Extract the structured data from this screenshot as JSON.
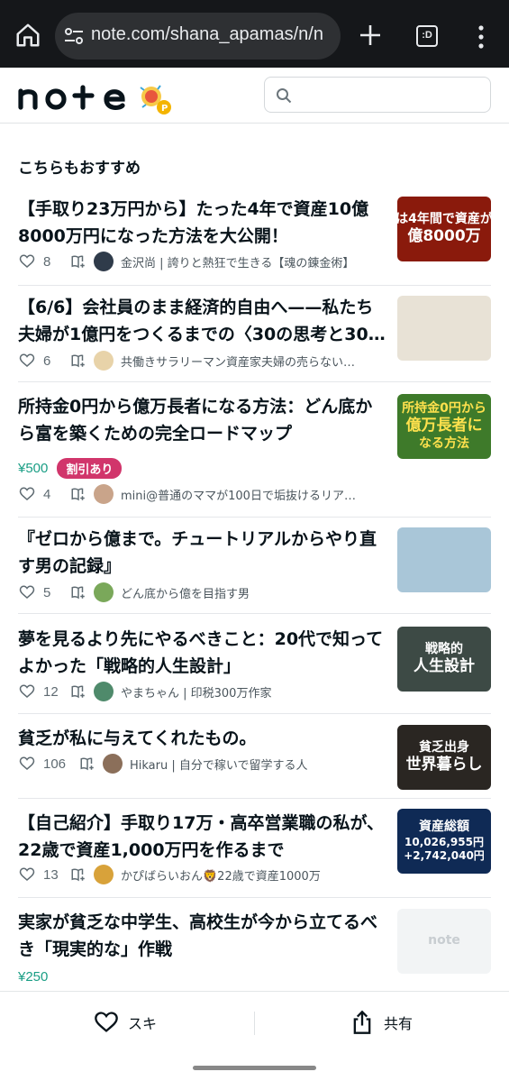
{
  "browser": {
    "url": "note.com/shana_apamas/n/n",
    "tab_icon_label": ":D"
  },
  "header": {
    "logo_text": "note",
    "search_placeholder": ""
  },
  "section": {
    "title": "こちらもおすすめ"
  },
  "articles": [
    {
      "title": "【手取り23万円から】たった4年で資産10億8000万円になった方法を大公開！",
      "likes": "8",
      "author": "金沢尚 | 誇りと熱狂で生きる【魂の錬金術】",
      "price": "",
      "badge": "",
      "thumb_text_1": "は4年間で資産が",
      "thumb_text_2": "億8000万",
      "thumb_bg": "#8a1a0c",
      "avatar_color": "#2f3b4a"
    },
    {
      "title": "【6/6】会社員のまま経済的自由へ——私たち夫婦が1億円をつくるまでの〈30の思考と30…",
      "likes": "6",
      "author": "共働きサラリーマン資産家夫婦の売らない…",
      "price": "",
      "badge": "",
      "thumb_text_1": "",
      "thumb_text_2": "",
      "thumb_bg": "#e8e2d6",
      "avatar_color": "#e8d3a9"
    },
    {
      "title": "所持金0円から億万長者になる方法：どん底から富を築くための完全ロードマップ",
      "likes": "4",
      "author": "mini@普通のママが100日で垢抜けるリア…",
      "price": "¥500",
      "badge": "割引あり",
      "thumb_text_1": "所持金0円から",
      "thumb_text_2": "億万長者に",
      "thumb_text_3": "なる方法",
      "thumb_bg": "#3e7a2a",
      "avatar_color": "#c9a48a"
    },
    {
      "title": "『ゼロから億まで。チュートリアルからやり直す男の記録』",
      "likes": "5",
      "author": "どん底から億を目指す男",
      "price": "",
      "badge": "",
      "thumb_text_1": "",
      "thumb_text_2": "",
      "thumb_bg": "#a9c6d8",
      "avatar_color": "#7aa85a"
    },
    {
      "title": "夢を見るより先にやるべきこと：20代で知ってよかった「戦略的人生設計」",
      "likes": "12",
      "author": "やまちゃん | 印税300万作家",
      "price": "",
      "badge": "",
      "thumb_text_1": "戦略的",
      "thumb_text_2": "人生設計",
      "thumb_bg": "#3d4a45",
      "avatar_color": "#4f8a6b"
    },
    {
      "title": "貧乏が私に与えてくれたもの。",
      "likes": "106",
      "author": "Hikaru | 自分で稼いで留学する人",
      "price": "",
      "badge": "",
      "thumb_text_1": "貧乏出身",
      "thumb_text_2": "世界暮らし",
      "thumb_bg": "#2a2622",
      "avatar_color": "#8b6f5a"
    },
    {
      "title": "【自己紹介】手取り17万・高卒営業職の私が、22歳で資産1,000万円を作るまで",
      "likes": "13",
      "author": "かぴばらいおん🦁22歳で資産1000万",
      "price": "",
      "badge": "",
      "thumb_text_1": "資産総額",
      "thumb_text_2": "10,026,955円",
      "thumb_text_3": "+2,742,040円",
      "thumb_bg": "#0f2a55",
      "avatar_color": "#d8a23a"
    },
    {
      "title": "実家が貧乏な中学生、高校生が今から立てるべき「現実的な」作戦",
      "likes": "",
      "author": "",
      "price": "¥250",
      "badge": "",
      "thumb_text_1": "note",
      "thumb_text_2": "",
      "thumb_bg": "#f2f4f5",
      "avatar_color": ""
    }
  ],
  "bottom_bar": {
    "like_label": "スキ",
    "share_label": "共有"
  },
  "colors": {
    "price": "#1a9e85",
    "discount_badge": "#d1356b",
    "chrome_bg": "#15171a"
  }
}
